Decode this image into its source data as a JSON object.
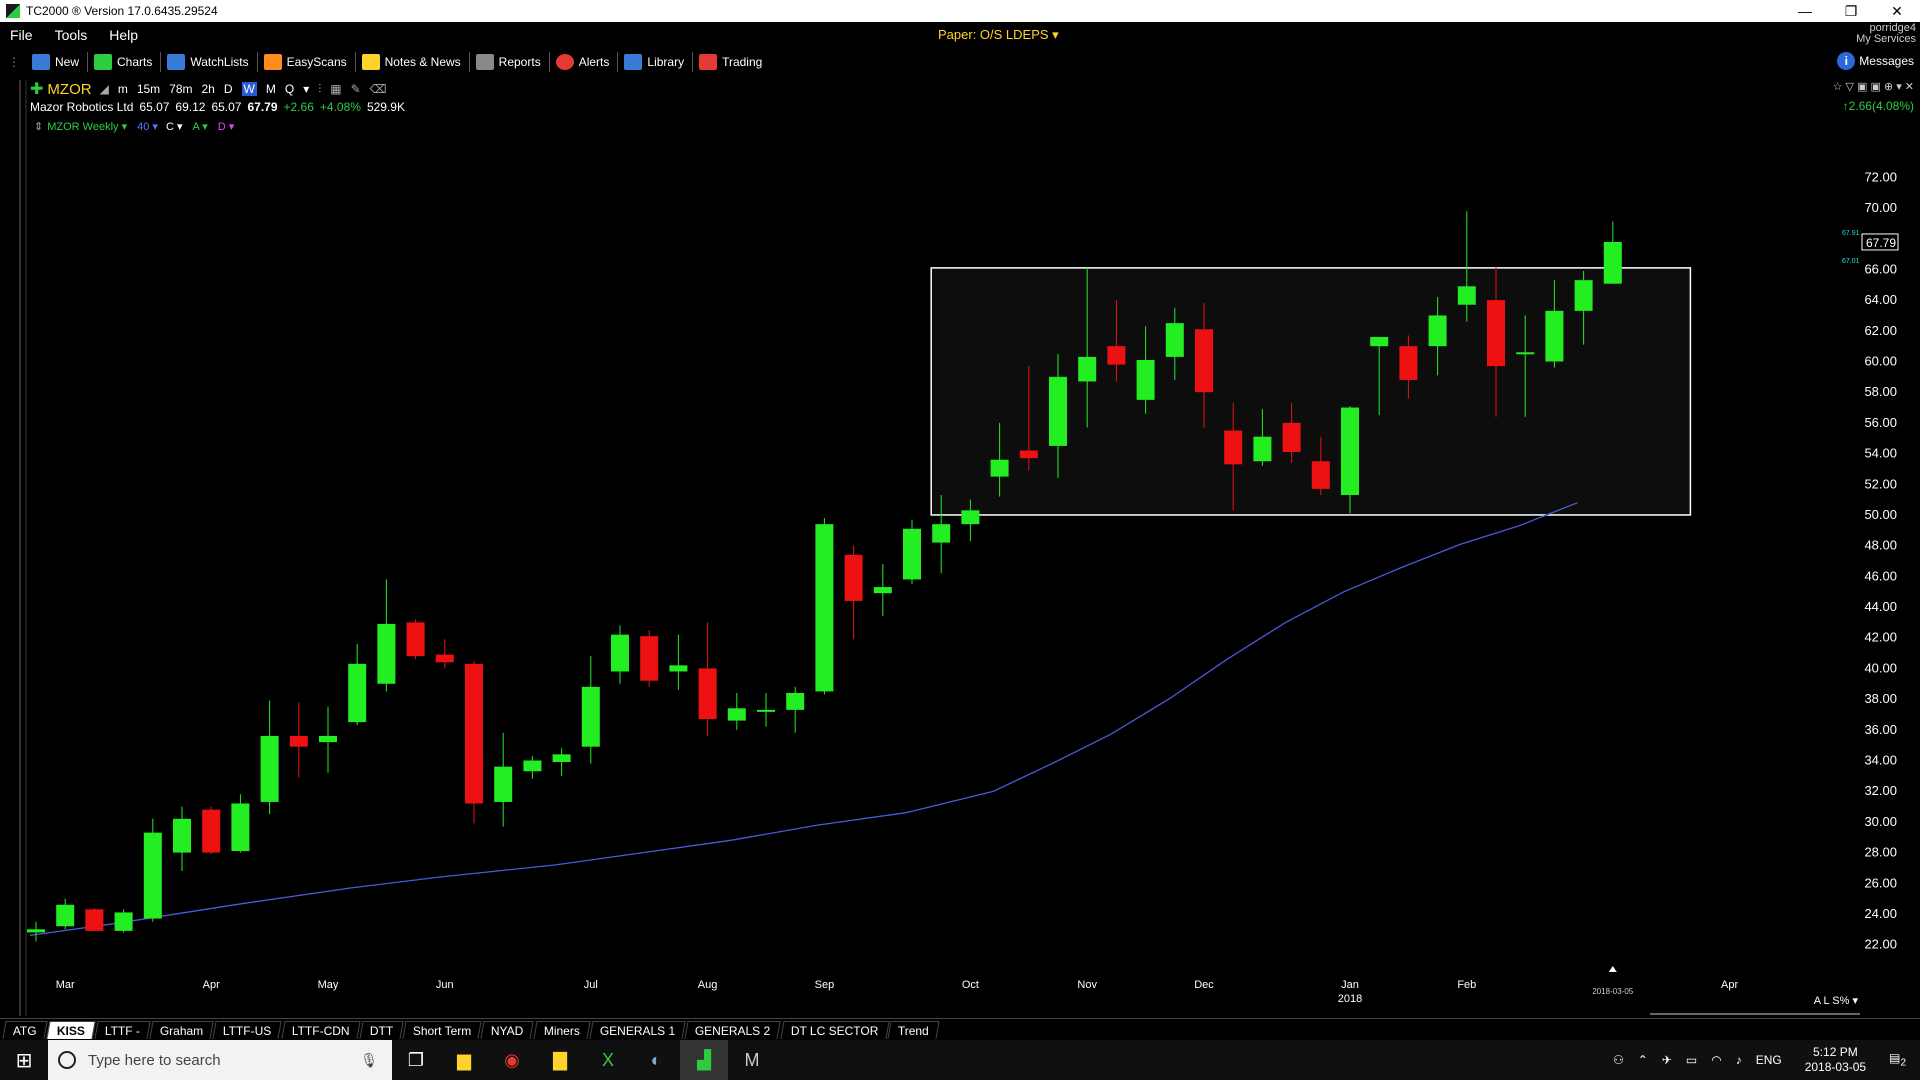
{
  "window": {
    "title": "TC2000 ® Version 17.0.6435.29524",
    "controls": [
      "—",
      "❐",
      "✕"
    ]
  },
  "menu": {
    "items": [
      "File",
      "Tools",
      "Help"
    ],
    "paper": "Paper: O/S LDEPS ▾",
    "user": "porridge4",
    "services": "My Services"
  },
  "toolbar": {
    "items": [
      {
        "label": "New",
        "icon": "new-icon",
        "color": "#3a7bd5"
      },
      {
        "label": "Charts",
        "icon": "charts-icon",
        "color": "#2ecc40"
      },
      {
        "label": "WatchLists",
        "icon": "watchlists-icon",
        "color": "#3a7bd5"
      },
      {
        "label": "EasyScans",
        "icon": "easyscans-icon",
        "color": "#ff8c1a"
      },
      {
        "label": "Notes & News",
        "icon": "notes-icon",
        "color": "#ffd42a"
      },
      {
        "label": "Reports",
        "icon": "reports-icon",
        "color": "#888888"
      },
      {
        "label": "Alerts",
        "icon": "alerts-icon",
        "color": "#e53935"
      },
      {
        "label": "Library",
        "icon": "library-icon",
        "color": "#3a7bd5"
      },
      {
        "label": "Trading",
        "icon": "trading-icon",
        "color": "#e53935"
      }
    ],
    "messages": "Messages"
  },
  "symbol": {
    "ticker": "MZOR",
    "timeframes": [
      "m",
      "15m",
      "78m",
      "2h",
      "D",
      "W",
      "M",
      "Q"
    ],
    "active_timeframe": "W",
    "name": "Mazor Robotics Ltd",
    "open": "65.07",
    "high": "69.12",
    "low": "65.07",
    "last": "67.79",
    "change": "+2.66",
    "change_pct": "+4.08%",
    "volume": "529.9K",
    "right_change": "↑2.66(4.08%)"
  },
  "indicator": {
    "name": "MZOR Weekly ▾",
    "length": "40 ▾",
    "c": "C ▾",
    "a": "A ▾",
    "d": "D ▾"
  },
  "chart_data": {
    "type": "candlestick",
    "title": "",
    "ylim": [
      21,
      73
    ],
    "y_ticks": [
      72,
      70,
      66,
      64,
      62,
      60,
      58,
      56,
      54,
      52,
      50,
      48,
      46,
      44,
      42,
      40,
      38,
      36,
      34,
      32,
      30,
      28,
      26,
      24,
      22
    ],
    "y_tick_labels": [
      "72.00",
      "70.00",
      "66.00",
      "64.00",
      "62.00",
      "60.00",
      "58.00",
      "56.00",
      "54.00",
      "52.00",
      "50.00",
      "48.00",
      "46.00",
      "44.00",
      "42.00",
      "40.00",
      "38.00",
      "36.00",
      "34.00",
      "32.00",
      "30.00",
      "28.00",
      "26.00",
      "24.00",
      "22.00"
    ],
    "last_price_label": "67.79",
    "last_price": 67.79,
    "marker_high": "67.91",
    "marker_low": "67.01",
    "x_labels": [
      {
        "label": "Mar",
        "week": 1
      },
      {
        "label": "Apr",
        "week": 6
      },
      {
        "label": "May",
        "week": 10
      },
      {
        "label": "Jun",
        "week": 14
      },
      {
        "label": "Jul",
        "week": 19
      },
      {
        "label": "Aug",
        "week": 23
      },
      {
        "label": "Sep",
        "week": 27
      },
      {
        "label": "Oct",
        "week": 32
      },
      {
        "label": "Nov",
        "week": 36
      },
      {
        "label": "Dec",
        "week": 40
      },
      {
        "label": "Jan",
        "week": 45
      },
      {
        "label": "Feb",
        "week": 49
      },
      {
        "label": "Apr",
        "week": 58
      }
    ],
    "year_label": {
      "label": "2018",
      "week": 45
    },
    "date_marker": {
      "label": "2018-03-05",
      "week": 54
    },
    "candles": [
      {
        "o": 22.8,
        "h": 23.5,
        "l": 22.2,
        "c": 23.0
      },
      {
        "o": 23.2,
        "h": 25.0,
        "l": 23.0,
        "c": 24.6
      },
      {
        "o": 24.3,
        "h": 24.4,
        "l": 22.9,
        "c": 22.9
      },
      {
        "o": 22.9,
        "h": 24.3,
        "l": 22.8,
        "c": 24.1
      },
      {
        "o": 23.7,
        "h": 30.2,
        "l": 23.5,
        "c": 29.3
      },
      {
        "o": 28.0,
        "h": 31.0,
        "l": 26.8,
        "c": 30.2
      },
      {
        "o": 30.8,
        "h": 31.0,
        "l": 27.9,
        "c": 28.0
      },
      {
        "o": 28.1,
        "h": 31.8,
        "l": 28.0,
        "c": 31.2
      },
      {
        "o": 31.3,
        "h": 37.9,
        "l": 30.5,
        "c": 35.6
      },
      {
        "o": 35.6,
        "h": 37.8,
        "l": 32.9,
        "c": 34.9
      },
      {
        "o": 35.2,
        "h": 37.5,
        "l": 33.2,
        "c": 35.6
      },
      {
        "o": 36.5,
        "h": 41.6,
        "l": 36.3,
        "c": 40.3
      },
      {
        "o": 39.0,
        "h": 45.8,
        "l": 38.5,
        "c": 42.9
      },
      {
        "o": 43.0,
        "h": 43.2,
        "l": 40.6,
        "c": 40.8
      },
      {
        "o": 40.9,
        "h": 41.9,
        "l": 40.0,
        "c": 40.4
      },
      {
        "o": 40.3,
        "h": 40.5,
        "l": 29.9,
        "c": 31.2
      },
      {
        "o": 31.3,
        "h": 35.8,
        "l": 29.7,
        "c": 33.6
      },
      {
        "o": 33.3,
        "h": 34.3,
        "l": 32.8,
        "c": 34.0
      },
      {
        "o": 33.9,
        "h": 34.8,
        "l": 33.0,
        "c": 34.4
      },
      {
        "o": 34.9,
        "h": 40.8,
        "l": 33.8,
        "c": 38.8
      },
      {
        "o": 39.8,
        "h": 42.8,
        "l": 39.0,
        "c": 42.2
      },
      {
        "o": 42.1,
        "h": 42.5,
        "l": 38.8,
        "c": 39.2
      },
      {
        "o": 39.8,
        "h": 42.2,
        "l": 38.6,
        "c": 40.2
      },
      {
        "o": 40.0,
        "h": 43.0,
        "l": 35.6,
        "c": 36.7
      },
      {
        "o": 36.6,
        "h": 38.4,
        "l": 36.0,
        "c": 37.4
      },
      {
        "o": 37.2,
        "h": 38.4,
        "l": 36.2,
        "c": 37.3
      },
      {
        "o": 37.3,
        "h": 38.8,
        "l": 35.8,
        "c": 38.4
      },
      {
        "o": 38.5,
        "h": 49.8,
        "l": 38.3,
        "c": 49.4
      },
      {
        "o": 47.4,
        "h": 48.0,
        "l": 41.9,
        "c": 44.4
      },
      {
        "o": 44.9,
        "h": 46.8,
        "l": 43.4,
        "c": 45.3
      },
      {
        "o": 45.8,
        "h": 49.7,
        "l": 45.5,
        "c": 49.1
      },
      {
        "o": 48.2,
        "h": 51.3,
        "l": 46.2,
        "c": 49.4
      },
      {
        "o": 49.4,
        "h": 51.0,
        "l": 48.3,
        "c": 50.3
      },
      {
        "o": 52.5,
        "h": 56.0,
        "l": 51.2,
        "c": 53.6
      },
      {
        "o": 54.2,
        "h": 59.7,
        "l": 52.9,
        "c": 53.7
      },
      {
        "o": 54.5,
        "h": 60.5,
        "l": 52.4,
        "c": 59.0
      },
      {
        "o": 58.7,
        "h": 66.1,
        "l": 55.7,
        "c": 60.3
      },
      {
        "o": 61.0,
        "h": 64.0,
        "l": 58.7,
        "c": 59.8
      },
      {
        "o": 57.5,
        "h": 62.3,
        "l": 56.6,
        "c": 60.1
      },
      {
        "o": 60.3,
        "h": 63.5,
        "l": 58.8,
        "c": 62.5
      },
      {
        "o": 62.1,
        "h": 63.8,
        "l": 55.7,
        "c": 58.0
      },
      {
        "o": 55.5,
        "h": 57.3,
        "l": 50.3,
        "c": 53.3
      },
      {
        "o": 53.5,
        "h": 56.9,
        "l": 53.2,
        "c": 55.1
      },
      {
        "o": 56.0,
        "h": 57.3,
        "l": 53.4,
        "c": 54.1
      },
      {
        "o": 53.5,
        "h": 55.1,
        "l": 51.3,
        "c": 51.7
      },
      {
        "o": 51.3,
        "h": 57.1,
        "l": 50.1,
        "c": 57.0
      },
      {
        "o": 61.0,
        "h": 61.6,
        "l": 56.5,
        "c": 61.6
      },
      {
        "o": 61.0,
        "h": 61.7,
        "l": 57.6,
        "c": 58.8
      },
      {
        "o": 61.0,
        "h": 64.2,
        "l": 59.1,
        "c": 63.0
      },
      {
        "o": 63.7,
        "h": 69.8,
        "l": 62.6,
        "c": 64.9
      },
      {
        "o": 64.0,
        "h": 66.2,
        "l": 56.4,
        "c": 59.7
      },
      {
        "o": 60.6,
        "h": 63.0,
        "l": 56.4,
        "c": 60.6
      },
      {
        "o": 60.0,
        "h": 65.3,
        "l": 59.6,
        "c": 63.3
      },
      {
        "o": 63.3,
        "h": 65.9,
        "l": 61.1,
        "c": 65.3
      },
      {
        "o": 65.07,
        "h": 69.12,
        "l": 65.07,
        "c": 67.79
      }
    ],
    "moving_average": {
      "length": 40,
      "values": [
        22.6,
        23.4,
        24.6,
        25.7,
        26.4,
        27.2,
        28.0,
        28.8,
        29.8,
        30.6,
        32.0,
        33.8,
        35.7,
        38.0,
        40.6,
        43.0,
        45.0,
        46.6,
        48.1,
        49.3,
        50.8
      ],
      "weeks": [
        0,
        3,
        7,
        11,
        14,
        18,
        21,
        24,
        27,
        30,
        33,
        35,
        37,
        39,
        41,
        43,
        45,
        47,
        49,
        51,
        53
      ]
    },
    "box": {
      "from_week": 31,
      "to_week": 57,
      "low": 50.0,
      "high": 66.1
    }
  },
  "tabs": {
    "items": [
      "ATG",
      "KISS",
      "LTTF -",
      "Graham",
      "LTTF-US",
      "LTTF-CDN",
      "DTT",
      "Short Term",
      "NYAD",
      "Miners",
      "GENERALS 1",
      "GENERALS 2",
      "DT LC SECTOR",
      "Trend"
    ],
    "active": "KISS"
  },
  "taskbar": {
    "search_placeholder": "Type here to search",
    "lang": "ENG",
    "time": "5:12 PM",
    "date": "2018-03-05",
    "notifications": "2"
  },
  "axis_footer": {
    "left_label": "L",
    "right_label": "A L S% ▾"
  }
}
